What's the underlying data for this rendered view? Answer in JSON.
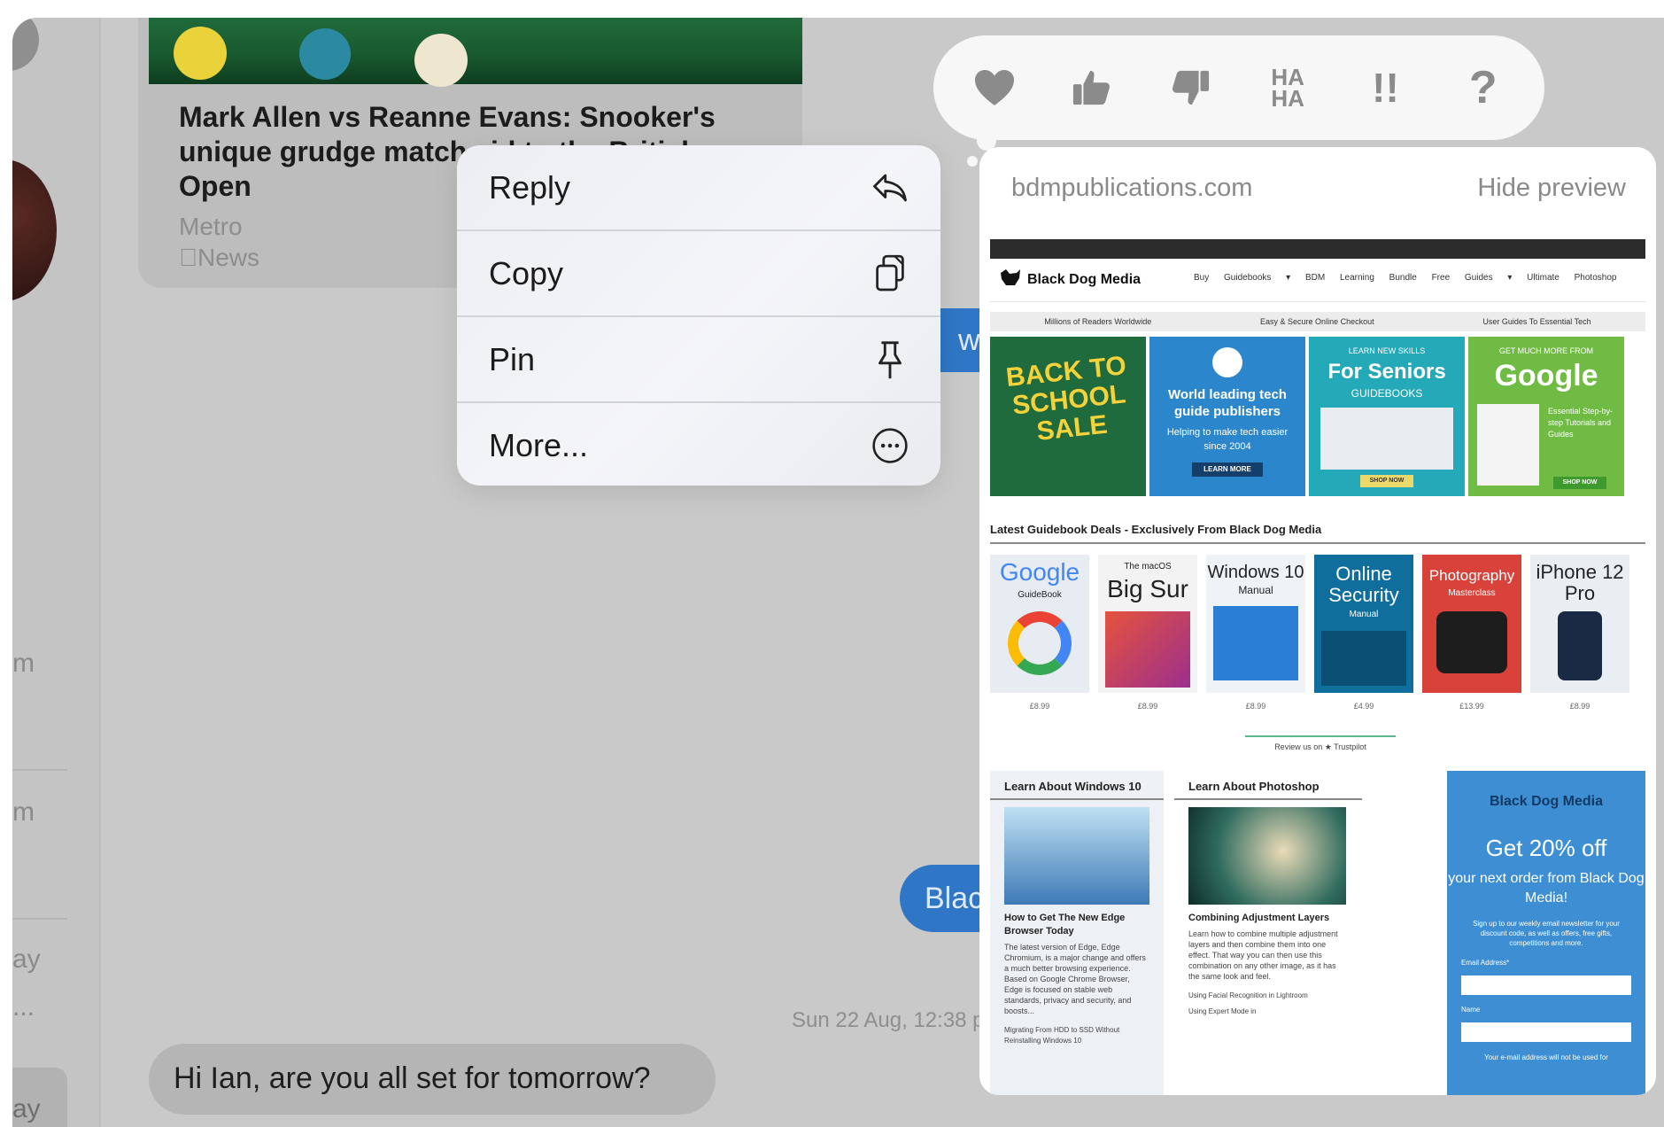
{
  "sidebar": {
    "fragments": [
      "m",
      "m",
      "ay",
      "...",
      "ay"
    ]
  },
  "news": {
    "title": "Mark Allen vs Reanne Evans: Snooker's unique grudge match",
    "title_tail": "aid to the British",
    "title_line3": "Open",
    "source": "Metro",
    "app": "News"
  },
  "chat": {
    "bubble_partial_top": "wo",
    "bubble_partial_bottom": "Blac",
    "timestamp": "Sun 22 Aug, 12:38 p",
    "incoming_message": "Hi Ian, are you all set for tomorrow?"
  },
  "reactions": [
    {
      "name": "heart",
      "icon": "heart-icon"
    },
    {
      "name": "thumbs-up",
      "icon": "thumbs-up-icon"
    },
    {
      "name": "thumbs-down",
      "icon": "thumbs-down-icon"
    },
    {
      "name": "haha",
      "label_top": "HA",
      "label_bottom": "HA"
    },
    {
      "name": "exclamation",
      "label": "!!"
    },
    {
      "name": "question",
      "label": "?"
    }
  ],
  "menu": {
    "items": [
      {
        "label": "Reply",
        "icon": "reply-icon"
      },
      {
        "label": "Copy",
        "icon": "copy-icon"
      },
      {
        "label": "Pin",
        "icon": "pin-icon"
      },
      {
        "label": "More...",
        "icon": "more-icon"
      }
    ]
  },
  "preview": {
    "domain": "bdmpublications.com",
    "hide_label": "Hide preview",
    "site": {
      "logo": "Black Dog Media",
      "menu": "Buy Guidebooks ▾ BDM Learning Bundle Free Guides ▾ Ultimate Photoshop",
      "strip": [
        "Millions of Readers Worldwide",
        "Easy & Secure Online Checkout",
        "User Guides To Essential Tech"
      ],
      "tiles": [
        {
          "big": "BACK TO SCHOOL SALE",
          "small": ""
        },
        {
          "big": "",
          "small": "World leading tech guide publishers",
          "small2": "Helping to make tech easier since 2004",
          "button": "LEARN MORE"
        },
        {
          "small": "LEARN NEW SKILLS",
          "big": "For Seniors",
          "small2": "GUIDEBOOKS",
          "button": "SHOP NOW"
        },
        {
          "small": "GET MUCH MORE FROM",
          "big": "Google",
          "small2": "Essential Step-by-step Tutorials and Guides",
          "button": "SHOP NOW"
        }
      ],
      "section_title": "Latest Guidebook Deals - Exclusively From Black Dog Media",
      "books": [
        {
          "title": "Google",
          "sub": "GuideBook",
          "price": "£8.99"
        },
        {
          "title": "Big Sur",
          "sub": "The macOS",
          "price": "£8.99"
        },
        {
          "title": "Windows 10",
          "sub": "Manual",
          "price": "£8.99"
        },
        {
          "title": "Online Security",
          "sub": "Manual",
          "price": "£4.99"
        },
        {
          "title": "Photography",
          "sub": "Masterclass",
          "price": "£13.99"
        },
        {
          "title": "iPhone 12 Pro",
          "sub": "",
          "price": "£8.99"
        }
      ],
      "trust": "Review us on ★ Trustpilot",
      "col1": {
        "title": "Learn About Windows 10",
        "headline": "How to Get The New Edge Browser Today",
        "body": "The latest version of Edge, Edge Chromium, is a major change and offers a much better browsing experience. Based on Google Chrome Browser, Edge is focused on stable web standards, privacy and security, and boosts..."
      },
      "col1_extra": "Migrating From HDD to SSD Without Reinstalling Windows 10",
      "col2": {
        "title": "Learn About Photoshop",
        "headline": "Combining Adjustment Layers",
        "body": "Learn how to combine multiple adjustment layers and then combine them into one effect. That way you can then use this combination on any other image, as it has the same look and feel."
      },
      "col2_extra1": "Using Facial Recognition in Lightroom",
      "col2_extra2": "Using Expert Mode in",
      "promo": {
        "logo": "Black Dog Media",
        "big": "Get 20% off",
        "sub": "your next order from Black Dog Media!",
        "fine": "Sign up to our weekly email newsletter for your discount code, as well as offers, free gifts, competitions and more.",
        "email_label": "Email Address*",
        "name_label": "Name",
        "footer": "Your e-mail address will not be used for"
      }
    }
  }
}
